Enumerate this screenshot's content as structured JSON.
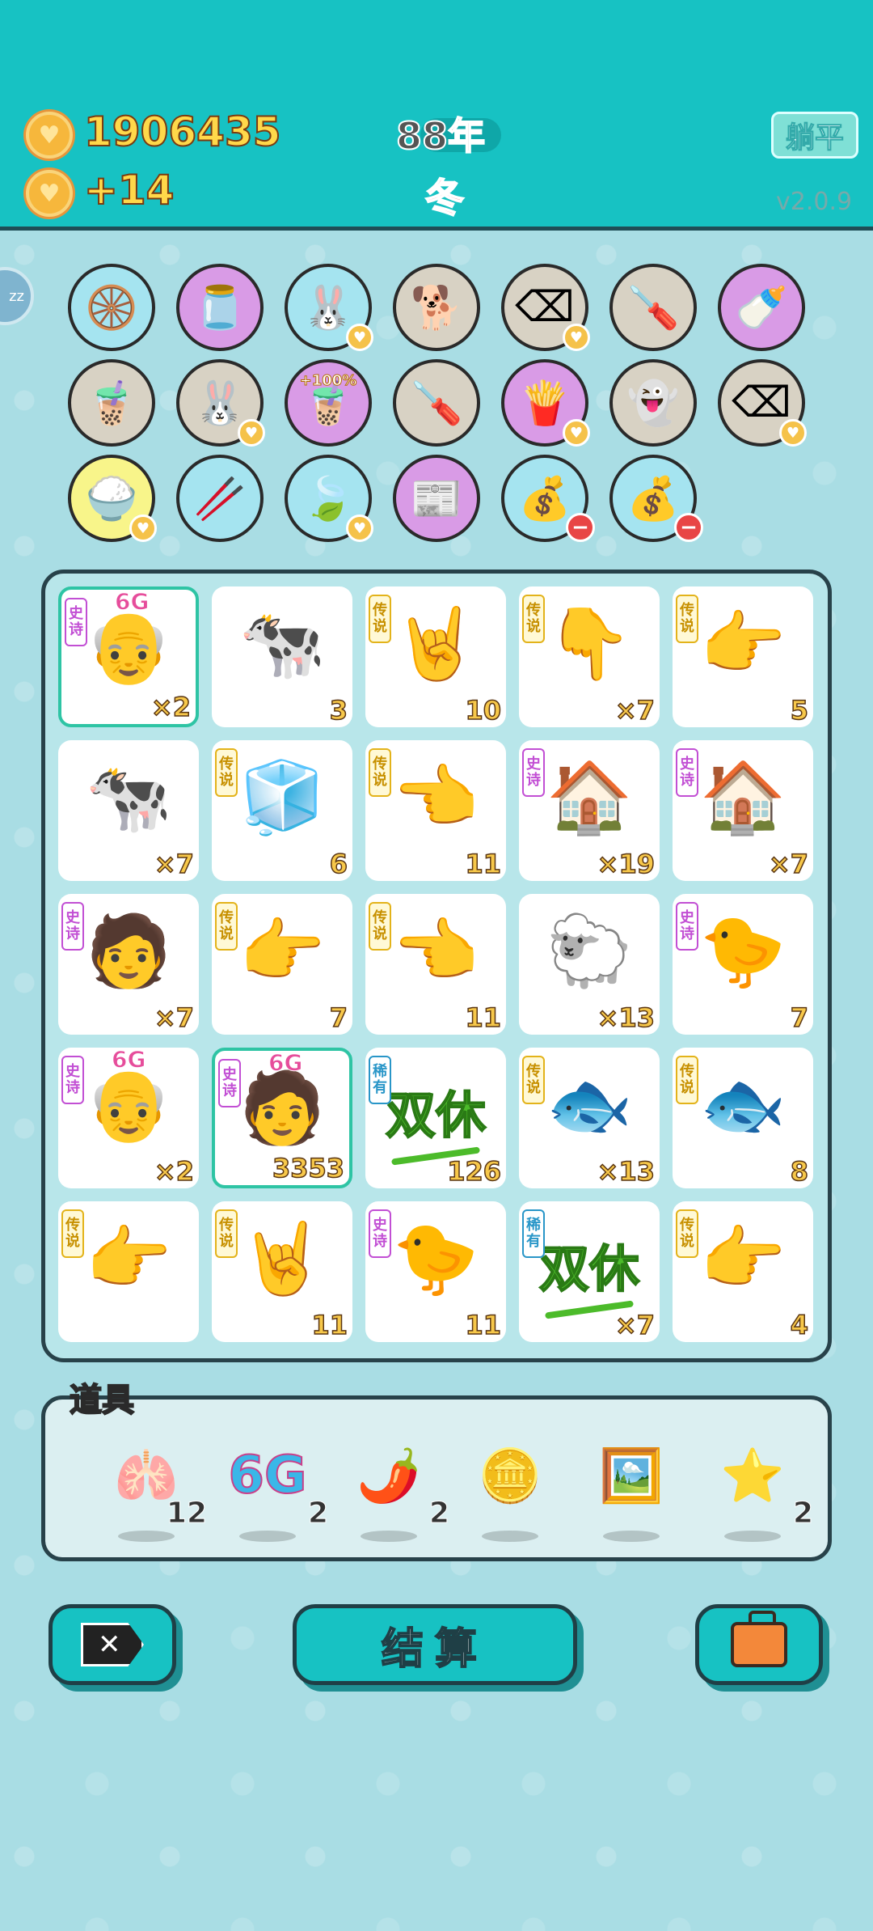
{
  "header": {
    "coins": "1906435",
    "income": "+14",
    "year": "88年",
    "season": "冬",
    "lie_flat_button": "躺平",
    "version": "v2.0.9",
    "zz_label": "zz"
  },
  "symbols": [
    {
      "name": "pump-icon",
      "glyph": "🛞",
      "bg": "#a5e4f0",
      "badge": ""
    },
    {
      "name": "milk-jar-icon",
      "glyph": "🫙",
      "bg": "#d99be6",
      "badge": ""
    },
    {
      "name": "rabbit-icon",
      "glyph": "🐰",
      "bg": "#a5e4f0",
      "badge": "heart"
    },
    {
      "name": "dog-icon",
      "glyph": "🐕",
      "bg": "#d8d2c4",
      "badge": ""
    },
    {
      "name": "delete-tag-icon",
      "glyph": "⌫",
      "bg": "#d8d2c4",
      "badge": "heart"
    },
    {
      "name": "screwdriver-icon",
      "glyph": "🪛",
      "bg": "#d8d2c4",
      "badge": ""
    },
    {
      "name": "breast-pump-icon",
      "glyph": "🍼",
      "bg": "#d99be6",
      "badge": ""
    },
    {
      "name": "bubble-tea-icon",
      "glyph": "🧋",
      "bg": "#d8d2c4",
      "badge": ""
    },
    {
      "name": "rabbit-icon",
      "glyph": "🐰",
      "bg": "#d8d2c4",
      "badge": "heart"
    },
    {
      "name": "bubble-tea-bonus-icon",
      "glyph": "🧋",
      "bg": "#d99be6",
      "badge": "",
      "text": "+100%"
    },
    {
      "name": "screwdriver-icon",
      "glyph": "🪛",
      "bg": "#d8d2c4",
      "badge": ""
    },
    {
      "name": "fries-icon",
      "glyph": "🍟",
      "bg": "#d99be6",
      "badge": "heart"
    },
    {
      "name": "ghost-icon",
      "glyph": "👻",
      "bg": "#d8d2c4",
      "badge": ""
    },
    {
      "name": "delete-tag-icon",
      "glyph": "⌫",
      "bg": "#d8d2c4",
      "badge": "heart"
    },
    {
      "name": "rice-bowl-icon",
      "glyph": "🍚",
      "bg": "#f8f58a",
      "badge": "heart"
    },
    {
      "name": "chopsticks-icon",
      "glyph": "🥢",
      "bg": "#a5e4f0",
      "badge": ""
    },
    {
      "name": "leaf-icon",
      "glyph": "🍃",
      "bg": "#a5e4f0",
      "badge": "heart"
    },
    {
      "name": "time-magazine-icon",
      "glyph": "📰",
      "bg": "#d99be6",
      "badge": ""
    },
    {
      "name": "money-bag-icon",
      "glyph": "💰",
      "bg": "#a5e4f0",
      "badge": "minus"
    },
    {
      "name": "money-bag-icon",
      "glyph": "💰",
      "bg": "#a5e4f0",
      "badge": "minus"
    }
  ],
  "tags": {
    "epic": "史诗",
    "legend": "传说",
    "rare": "稀有",
    "six_g": "6G"
  },
  "board": [
    {
      "name": "old-man-cell",
      "glyph": "👴",
      "tag": "epic",
      "g6": true,
      "value": "×2",
      "selected": true
    },
    {
      "name": "cow-cell",
      "glyph": "🐄",
      "tag": "",
      "value": "3"
    },
    {
      "name": "rock-hand-cell",
      "glyph": "🤘",
      "tag": "legend",
      "value": "10"
    },
    {
      "name": "point-down-hand-cell",
      "glyph": "👇",
      "tag": "legend",
      "value": "×7"
    },
    {
      "name": "point-right-hand-cell",
      "glyph": "👉",
      "tag": "legend",
      "value": "5"
    },
    {
      "name": "cow-cell",
      "glyph": "🐄",
      "tag": "",
      "value": "×7"
    },
    {
      "name": "fridge-cell",
      "glyph": "🧊",
      "tag": "legend",
      "value": "6"
    },
    {
      "name": "point-left-hand-cell",
      "glyph": "👈",
      "tag": "legend",
      "value": "11"
    },
    {
      "name": "rabbit-house-cell",
      "glyph": "🏠",
      "tag": "epic",
      "value": "×19"
    },
    {
      "name": "rabbit-house-cell",
      "glyph": "🏠",
      "tag": "epic",
      "value": "×7"
    },
    {
      "name": "green-hat-man-cell",
      "glyph": "🧑",
      "tag": "epic",
      "value": "×7"
    },
    {
      "name": "point-right-hand-cell",
      "glyph": "👉",
      "tag": "legend",
      "value": "7"
    },
    {
      "name": "point-left-hand-cell",
      "glyph": "👈",
      "tag": "legend",
      "value": "11"
    },
    {
      "name": "sheep-cell",
      "glyph": "🐑",
      "tag": "",
      "value": "×13"
    },
    {
      "name": "chick-grandpa-cell",
      "glyph": "🐤",
      "tag": "epic",
      "value": "7"
    },
    {
      "name": "old-man-cell",
      "glyph": "👴",
      "tag": "epic",
      "g6": true,
      "value": "×2"
    },
    {
      "name": "green-hat-man-cell",
      "glyph": "🧑",
      "tag": "epic",
      "g6": true,
      "value": "3353",
      "selected": true
    },
    {
      "name": "double-rest-cell",
      "glyph": "",
      "text": "双休",
      "tag": "rare",
      "value": "126"
    },
    {
      "name": "koi-fish-cell",
      "glyph": "🐟",
      "tag": "legend",
      "value": "×13"
    },
    {
      "name": "koi-fish-cell",
      "glyph": "🐟",
      "tag": "legend",
      "value": "8"
    },
    {
      "name": "point-right-hand-cell",
      "glyph": "👉",
      "tag": "legend",
      "value": ""
    },
    {
      "name": "rock-hand-cell",
      "glyph": "🤘",
      "tag": "legend",
      "value": "11"
    },
    {
      "name": "chick-grandpa-cell",
      "glyph": "🐤",
      "tag": "epic",
      "value": "11"
    },
    {
      "name": "double-rest-cell",
      "glyph": "",
      "text": "双休",
      "tag": "rare",
      "value": "×7"
    },
    {
      "name": "point-right-hand-cell",
      "glyph": "👉",
      "tag": "legend",
      "value": "4"
    }
  ],
  "props": {
    "label": "道具",
    "items": [
      {
        "name": "liver-icon",
        "glyph": "🫁",
        "count": "12"
      },
      {
        "name": "six-g-icon",
        "text": "6G",
        "count": "2"
      },
      {
        "name": "chili-icon",
        "glyph": "🌶️",
        "count": "2"
      },
      {
        "name": "dollar-coin-icon",
        "glyph": "🪙",
        "count": ""
      },
      {
        "name": "rabbit-house-frame-icon",
        "glyph": "🖼️",
        "count": ""
      },
      {
        "name": "star-icon",
        "glyph": "⭐",
        "count": "2"
      }
    ]
  },
  "buttons": {
    "settle": "结算",
    "delete_symbol": "✕"
  }
}
